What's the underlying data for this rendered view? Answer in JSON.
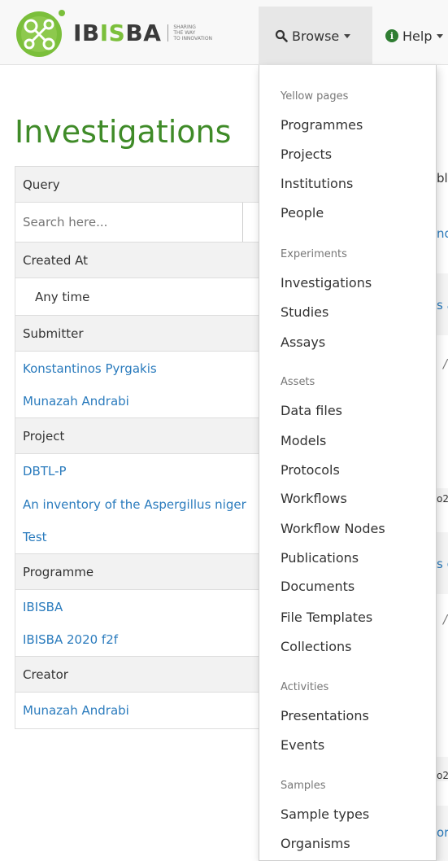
{
  "brand": {
    "name_left": "IB",
    "name_mid": "IS",
    "name_right": "BA",
    "tagline": [
      "SHARING",
      "THE WAY",
      "TO INNOVATION"
    ],
    "color_primary": "#7bbf3b",
    "color_dark": "#3a3a3a"
  },
  "nav": {
    "browse_label": "Browse",
    "browse_icon": "search-icon",
    "help_label": "Help",
    "help_icon": "info-circle-icon"
  },
  "page": {
    "title": "Investigations"
  },
  "facets": {
    "query_header": "Query",
    "search_placeholder": "Search here...",
    "created_at_header": "Created At",
    "created_at_value": "Any time",
    "submitter_header": "Submitter",
    "submitters": [
      "Konstantinos Pyrgakis",
      "Munazah Andrabi"
    ],
    "project_header": "Project",
    "projects": [
      "DBTL-P",
      "An inventory of the Aspergillus niger",
      "Test"
    ],
    "programme_header": "Programme",
    "programmes": [
      "IBISBA",
      "IBISBA 2020 f2f"
    ],
    "creator_header": "Creator",
    "creators": [
      "Munazah Andrabi"
    ]
  },
  "peek": {
    "row1": "bl",
    "row2": "nd",
    "row3": "s a",
    "row4": "/",
    "row5": "o2",
    "row6": "s c",
    "row7": "/",
    "row8": "o2",
    "row9": "or"
  },
  "dropdown": {
    "sections": [
      {
        "header": "Yellow pages",
        "items": [
          "Programmes",
          "Projects",
          "Institutions",
          "People"
        ]
      },
      {
        "header": "Experiments",
        "items": [
          "Investigations",
          "Studies",
          "Assays"
        ]
      },
      {
        "header": "Assets",
        "items": [
          "Data files",
          "Models",
          "Protocols",
          "Workflows",
          "Workflow Nodes",
          "Publications",
          "Documents",
          "File Templates",
          "Collections"
        ]
      },
      {
        "header": "Activities",
        "items": [
          "Presentations",
          "Events"
        ]
      },
      {
        "header": "Samples",
        "items": [
          "Sample types",
          "Organisms"
        ]
      }
    ]
  },
  "colors": {
    "title_green": "#3f8b28",
    "link_blue": "#2a7bbd",
    "nav_active_bg": "#e7e7e7"
  }
}
